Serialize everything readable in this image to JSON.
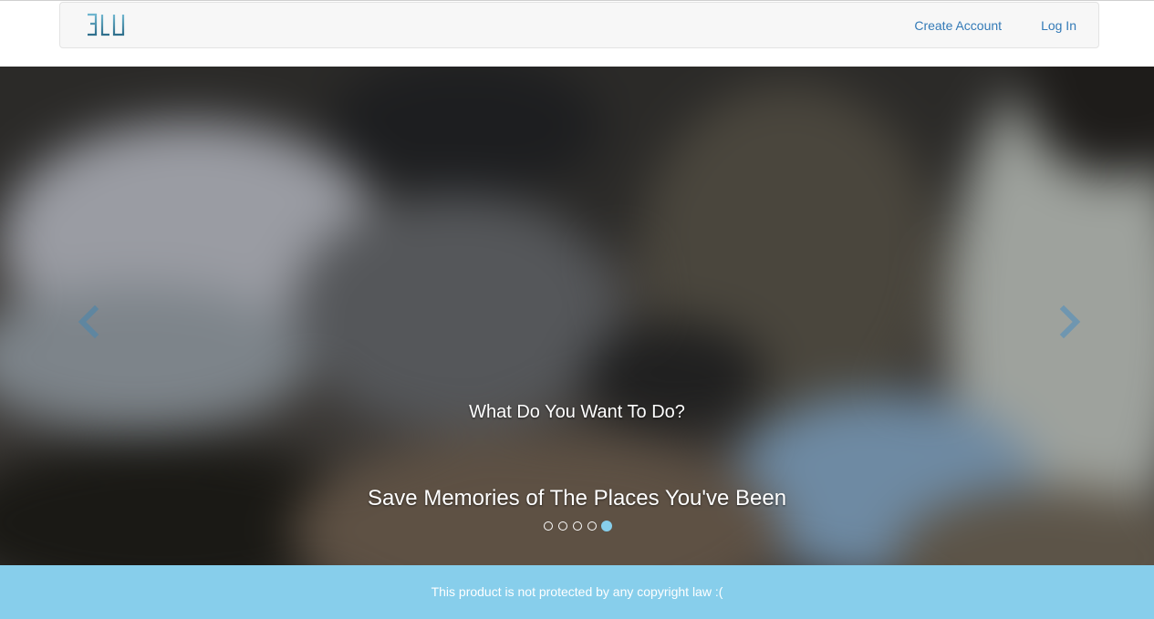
{
  "navbar": {
    "brand_logo": "3LU",
    "links": [
      {
        "label": "Create Account"
      },
      {
        "label": "Log In"
      }
    ]
  },
  "carousel": {
    "question": "What Do You Want To Do?",
    "caption": "Save Memories of The Places You've Been",
    "indicator_count": 5,
    "active_index": 4,
    "prev_icon": "chevron-left-icon",
    "next_icon": "chevron-right-icon"
  },
  "footer": {
    "text": "This product is not protected by any copyright law :("
  },
  "colors": {
    "accent": "#87ceeb",
    "link": "#337ab7",
    "navbar_bg": "#f7f7f7"
  }
}
